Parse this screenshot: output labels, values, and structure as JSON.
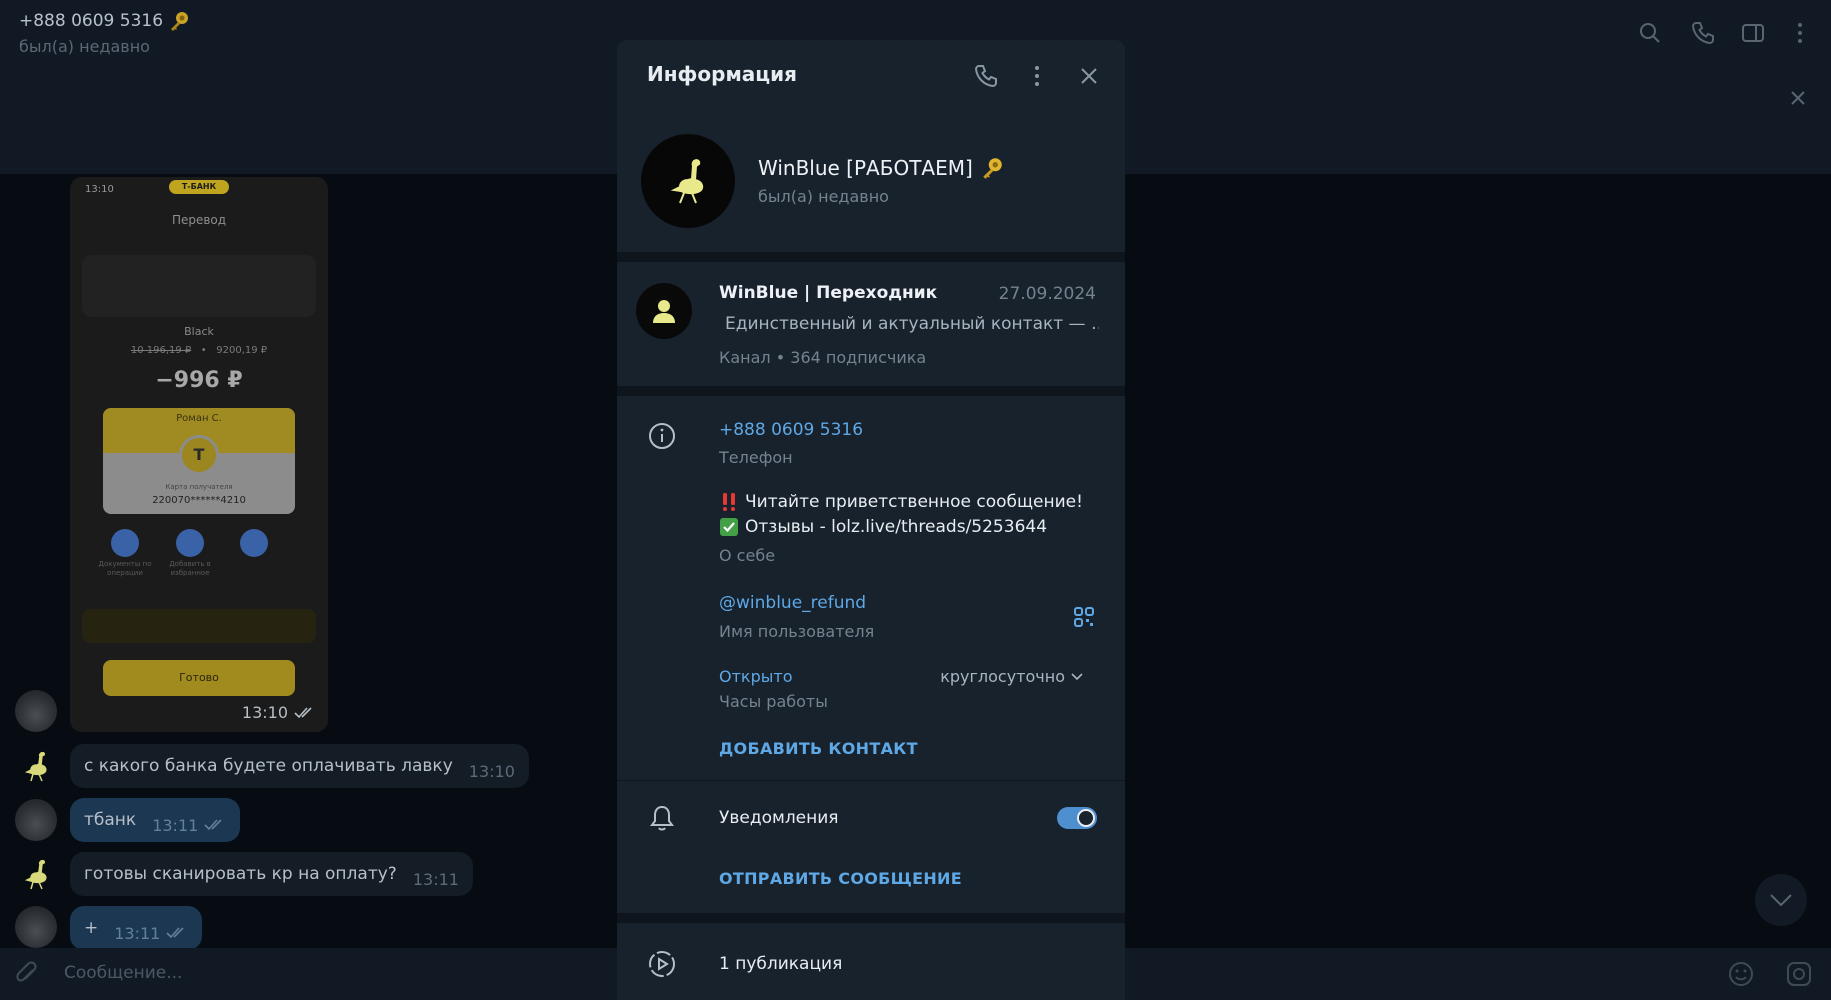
{
  "chat": {
    "title": "+888 0609 5316",
    "status": "был(а) недавно",
    "input_placeholder": "Сообщение..."
  },
  "phone_screenshot": {
    "time": "13:10",
    "bank": "Т-БАНК",
    "title": "Перевод",
    "card_type": "Black",
    "balance_old": "10 196,19 ₽",
    "balance_new": "9200,19 ₽",
    "amount": "−996 ₽",
    "recipient": "Роман С.",
    "logo_letter": "Т",
    "card_label": "Карта получателя",
    "card_number": "220070******4210",
    "actions": [
      "Документы по операции",
      "Добавить в избранное",
      ""
    ],
    "done_label": "Готово",
    "msg_time": "13:10"
  },
  "messages": [
    {
      "text": "с какого банка будете оплачивать лавку",
      "time": "13:10",
      "outgoing": false
    },
    {
      "text": "тбанк",
      "time": "13:11",
      "outgoing": true
    },
    {
      "text": "готовы сканировать кр на оплату?",
      "time": "13:11",
      "outgoing": false
    },
    {
      "text": "+",
      "time": "13:11",
      "outgoing": true
    }
  ],
  "panel": {
    "title": "Информация",
    "profile_name": "WinBlue [РАБОТАЕМ]",
    "profile_status": "был(а) недавно",
    "channel": {
      "name": "WinBlue | Переходник",
      "date": "27.09.2024",
      "desc": "Единственный и актуальный контакт — …",
      "meta": "Канал • 364 подписчика"
    },
    "phone": "+888 0609 5316",
    "phone_label": "Телефон",
    "bio_line1": "Читайте приветственное сообщение!",
    "bio_line2": "Отзывы - lolz.live/threads/5253644",
    "bio_label": "О себе",
    "username": "@winblue_refund",
    "username_label": "Имя пользователя",
    "hours_status": "Открыто",
    "hours_value": "круглосуточно",
    "hours_label": "Часы работы",
    "add_contact": "ДОБАВИТЬ КОНТАКТ",
    "notifications": "Уведомления",
    "notifications_on": true,
    "send_message": "ОТПРАВИТЬ СООБЩЕНИЕ",
    "publications": "1 публикация"
  },
  "colors": {
    "accent": "#5ea8e6",
    "toggle": "#4e8fcf",
    "panel_bg": "#18222d",
    "ostrich": "#e8e98a",
    "bank_yellow": "#bfa41f"
  },
  "icons": [
    "search-icon",
    "phone-icon",
    "sidebar-icon",
    "more-icon",
    "close-icon",
    "info-icon",
    "bell-icon",
    "stories-icon",
    "qr-icon",
    "attach-icon",
    "emoji-icon",
    "camera-icon",
    "chevron-down-icon",
    "key-icon",
    "user-icon",
    "ostrich-icon"
  ]
}
